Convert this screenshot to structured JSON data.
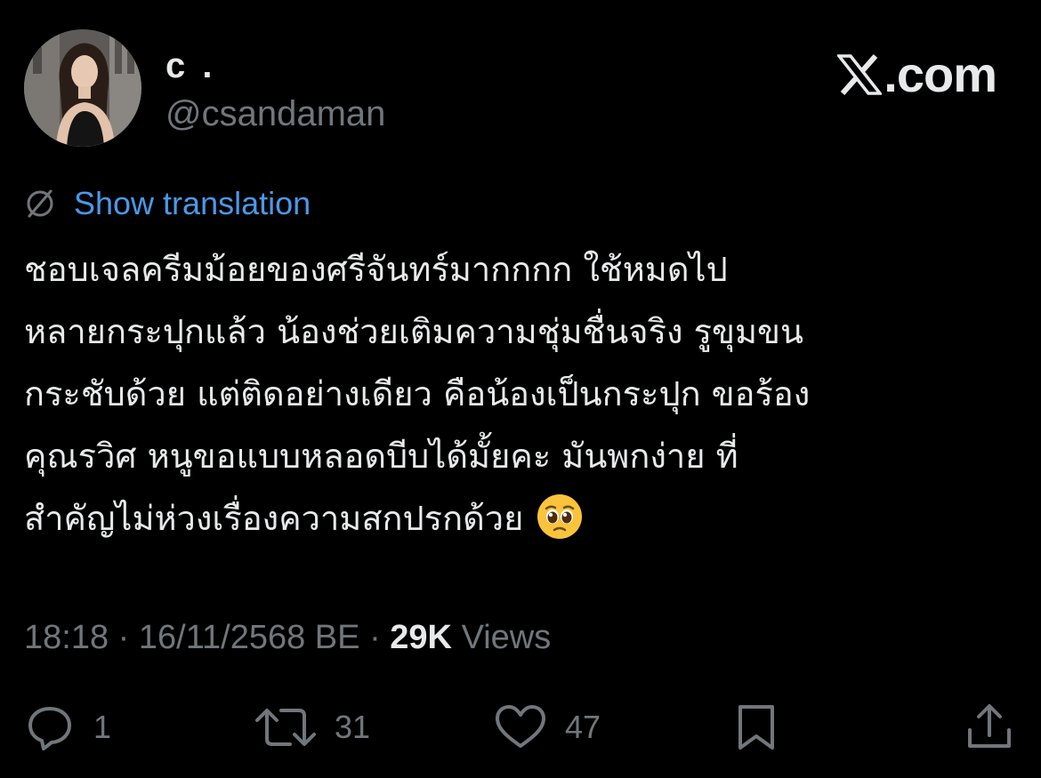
{
  "author": {
    "display_name": "c .",
    "handle": "@csandaman"
  },
  "brand": {
    "domain": ".com",
    "icon": "x-logo-icon"
  },
  "translation": {
    "label": "Show translation",
    "icon": "translate-globe-icon"
  },
  "tweet": {
    "lines": [
      "ชอบเจลครีมม้อยของศรีจันทร์มากกกก ใช้หมดไป",
      "หลายกระปุกแล้ว น้องช่วยเติมความชุ่มชื่นจริง รูขุมขน",
      "กระชับด้วย แต่ติดอย่างเดียว คือน้องเป็นกระปุก ขอร้อง",
      "คุณรวิศ หนูขอแบบหลอดบีบได้มั้ยคะ มันพกง่าย ที่",
      "สำคัญไม่ห่วงเรื่องความสกปรกด้วย"
    ],
    "emoji": "pleading-face"
  },
  "meta": {
    "time": "18:18",
    "separator": "·",
    "date": "16/11/2568 BE",
    "views_count": "29K",
    "views_label": "Views"
  },
  "actions": {
    "reply": {
      "count": "1",
      "icon": "reply-icon"
    },
    "repost": {
      "count": "31",
      "icon": "repost-icon"
    },
    "like": {
      "count": "47",
      "icon": "heart-icon"
    },
    "bookmark": {
      "icon": "bookmark-icon"
    },
    "share": {
      "icon": "share-icon"
    }
  },
  "colors": {
    "background": "#000000",
    "primary_text": "#e7e9ea",
    "secondary_text": "#71767b",
    "link": "#4a99e9"
  }
}
